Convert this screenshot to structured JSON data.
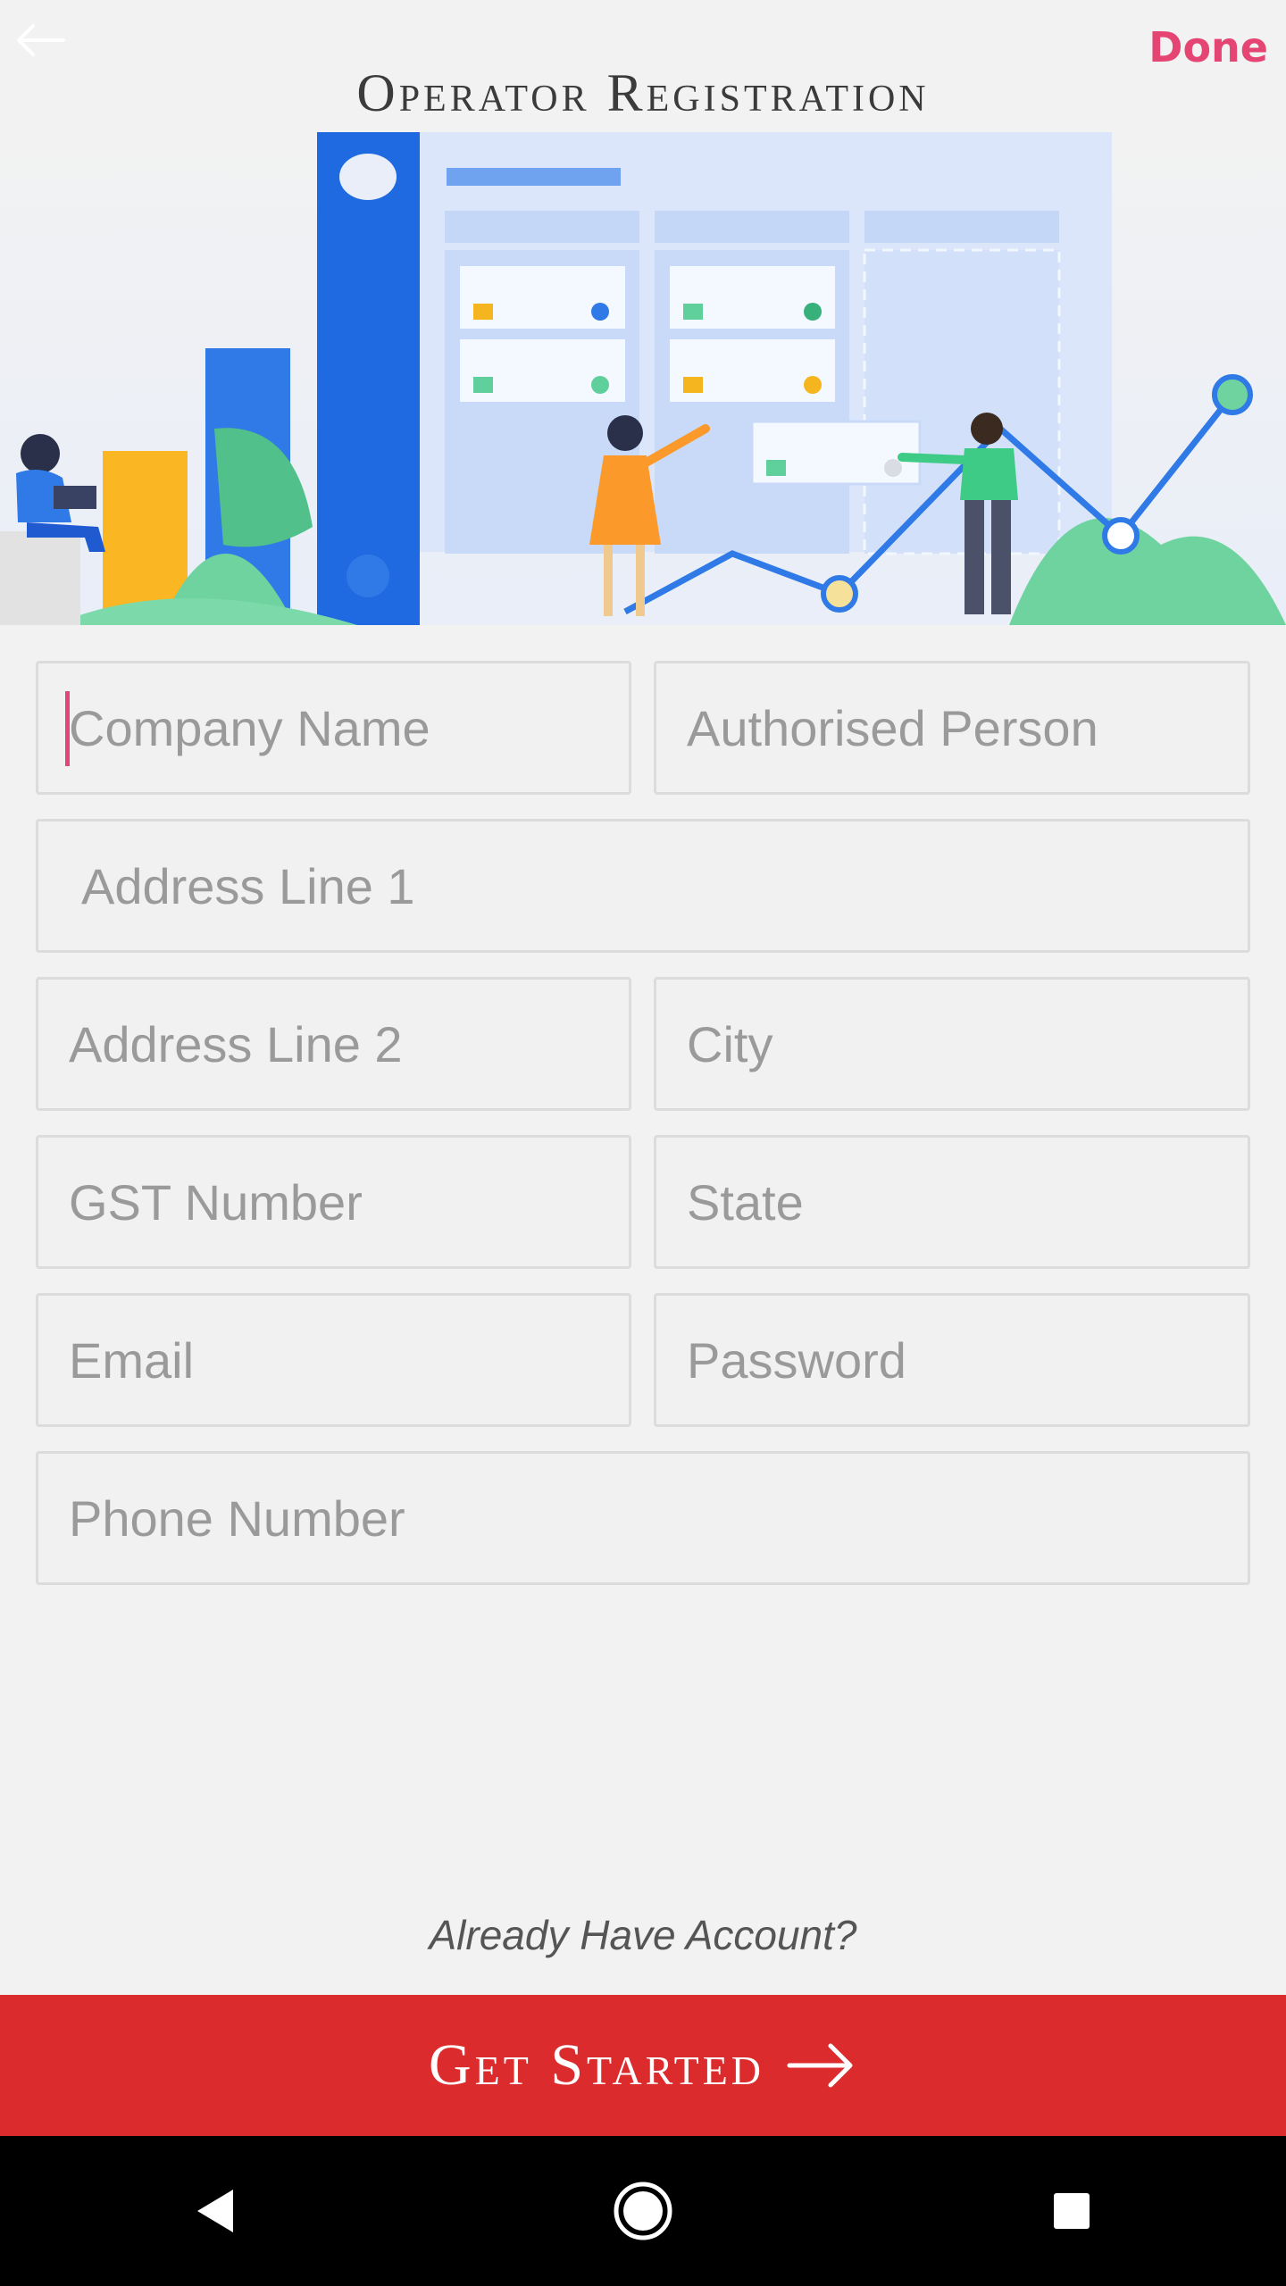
{
  "header": {
    "title": "Operator Registration",
    "done_label": "Done"
  },
  "form": {
    "company_name": "Company Name",
    "authorised_person": "Authorised Person",
    "address_line_1": "Address Line 1",
    "address_line_2": "Address Line 2",
    "city": "City",
    "gst_number": "GST Number",
    "state": "State",
    "email": "Email",
    "password": "Password",
    "phone_number": "Phone Number"
  },
  "footer": {
    "already_account": "Already Have Account?",
    "cta_label": "Get Started"
  },
  "colors": {
    "accent": "#e54573",
    "cta": "#dc2b2d",
    "background": "#f2f2f2"
  },
  "icons": {
    "back": "arrow-left-icon",
    "cta": "arrow-right-icon",
    "nav_back": "triangle-back-icon",
    "nav_home": "circle-home-icon",
    "nav_recent": "square-recent-icon"
  }
}
